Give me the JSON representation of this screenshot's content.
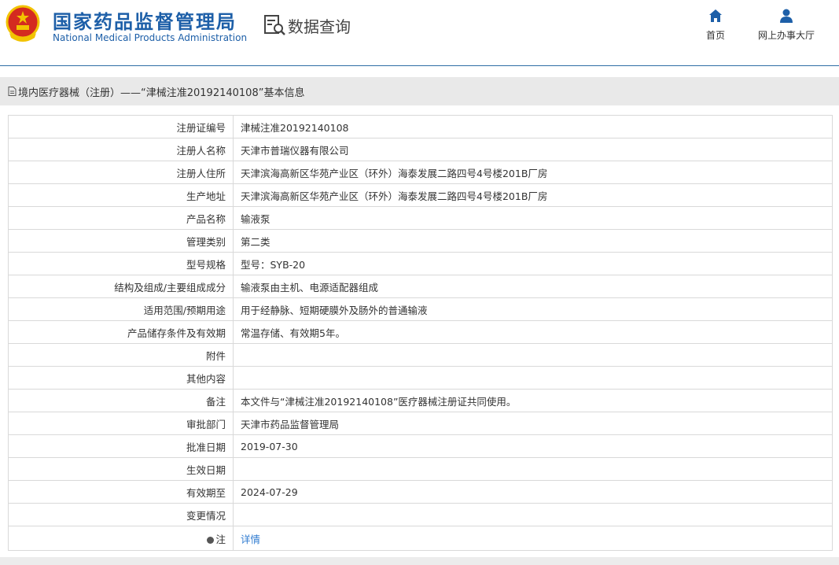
{
  "header": {
    "site_name_cn": "国家药品监督管理局",
    "site_name_en": "National Medical Products Administration",
    "section_title": "数据查询",
    "nav": [
      {
        "label": "首页",
        "icon": "home-icon"
      },
      {
        "label": "网上办事大厅",
        "icon": "user-icon"
      }
    ]
  },
  "breadcrumb": {
    "text": "境内医疗器械（注册）——“津械注准20192140108”基本信息",
    "icon": "document-icon"
  },
  "record": [
    {
      "label": "注册证编号",
      "value": "津械注准20192140108"
    },
    {
      "label": "注册人名称",
      "value": "天津市普瑞仪器有限公司"
    },
    {
      "label": "注册人住所",
      "value": "天津滨海高新区华苑产业区（环外）海泰发展二路四号4号楼201B厂房"
    },
    {
      "label": "生产地址",
      "value": "天津滨海高新区华苑产业区（环外）海泰发展二路四号4号楼201B厂房"
    },
    {
      "label": "产品名称",
      "value": "输液泵"
    },
    {
      "label": "管理类别",
      "value": "第二类"
    },
    {
      "label": "型号规格",
      "value": "型号：SYB-20"
    },
    {
      "label": "结构及组成/主要组成成分",
      "value": "输液泵由主机、电源适配器组成"
    },
    {
      "label": "适用范围/预期用途",
      "value": "用于经静脉、短期硬膜外及肠外的普通输液"
    },
    {
      "label": "产品储存条件及有效期",
      "value": "常温存储、有效期5年。"
    },
    {
      "label": "附件",
      "value": ""
    },
    {
      "label": "其他内容",
      "value": ""
    },
    {
      "label": "备注",
      "value": "本文件与“津械注准20192140108”医疗器械注册证共同使用。"
    },
    {
      "label": "审批部门",
      "value": "天津市药品监督管理局"
    },
    {
      "label": "批准日期",
      "value": "2019-07-30"
    },
    {
      "label": "生效日期",
      "value": ""
    },
    {
      "label": "有效期至",
      "value": "2024-07-29"
    },
    {
      "label": "变更情况",
      "value": ""
    }
  ],
  "note_row": {
    "label": "注",
    "link_text": "详情"
  },
  "colors": {
    "brand_blue": "#1d5fa8",
    "link_blue": "#2f7bd0",
    "emblem_red": "#d42a20",
    "emblem_gold": "#f2c300",
    "bar_gray": "#e9e9e9"
  }
}
